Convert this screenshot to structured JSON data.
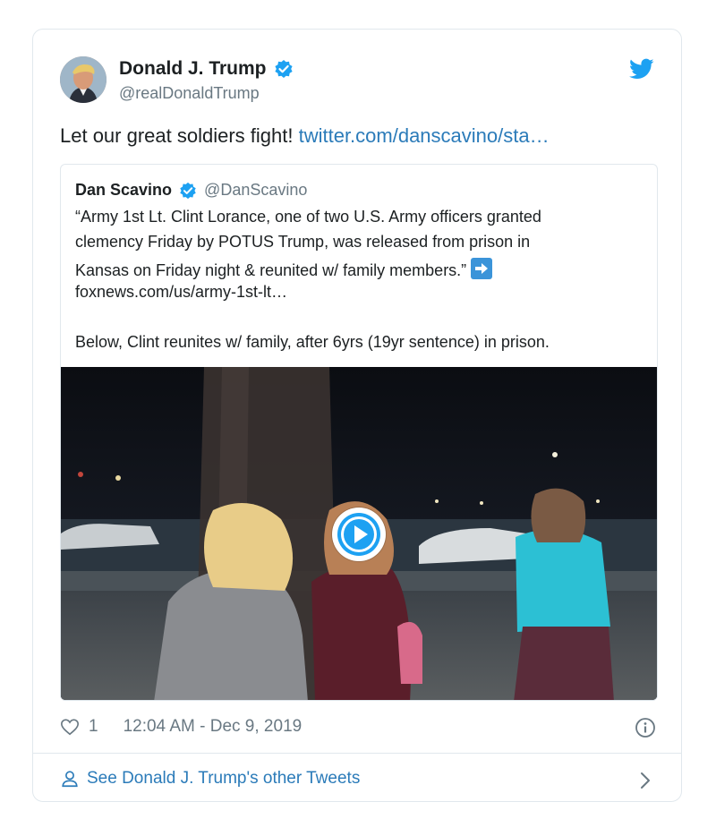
{
  "author": {
    "name": "Donald J. Trump",
    "handle": "@realDonaldTrump"
  },
  "tweet": {
    "text": "Let our great soldiers fight! ",
    "link": "twitter.com/danscavino/sta…"
  },
  "quoted": {
    "name": "Dan Scavino",
    "handle": "@DanScavino",
    "lines": [
      "“Army 1st Lt. Clint Lorance, one of two U.S. Army officers granted",
      "clemency Friday by POTUS Trump, was released from prison in",
      "Kansas on Friday night & reunited w/ family members.”",
      "foxnews.com/us/army-1st-lt…",
      "Below, Clint reunites w/ family, after 6yrs (19yr sentence) in prison."
    ]
  },
  "footer": {
    "likes": "1",
    "timestamp": "12:04 AM - Dec 9, 2019"
  },
  "see_more": "See Donald J. Trump's other Tweets",
  "colors": {
    "link": "#2b7bb9",
    "verified": "#1da1f2",
    "muted": "#697882",
    "border": "#e1e8ed"
  },
  "icons": [
    "avatar",
    "verified-badge-icon",
    "twitter-bird-icon",
    "right-arrow-emoji-icon",
    "play-icon",
    "heart-icon",
    "info-icon",
    "person-icon",
    "chevron-right-icon"
  ]
}
